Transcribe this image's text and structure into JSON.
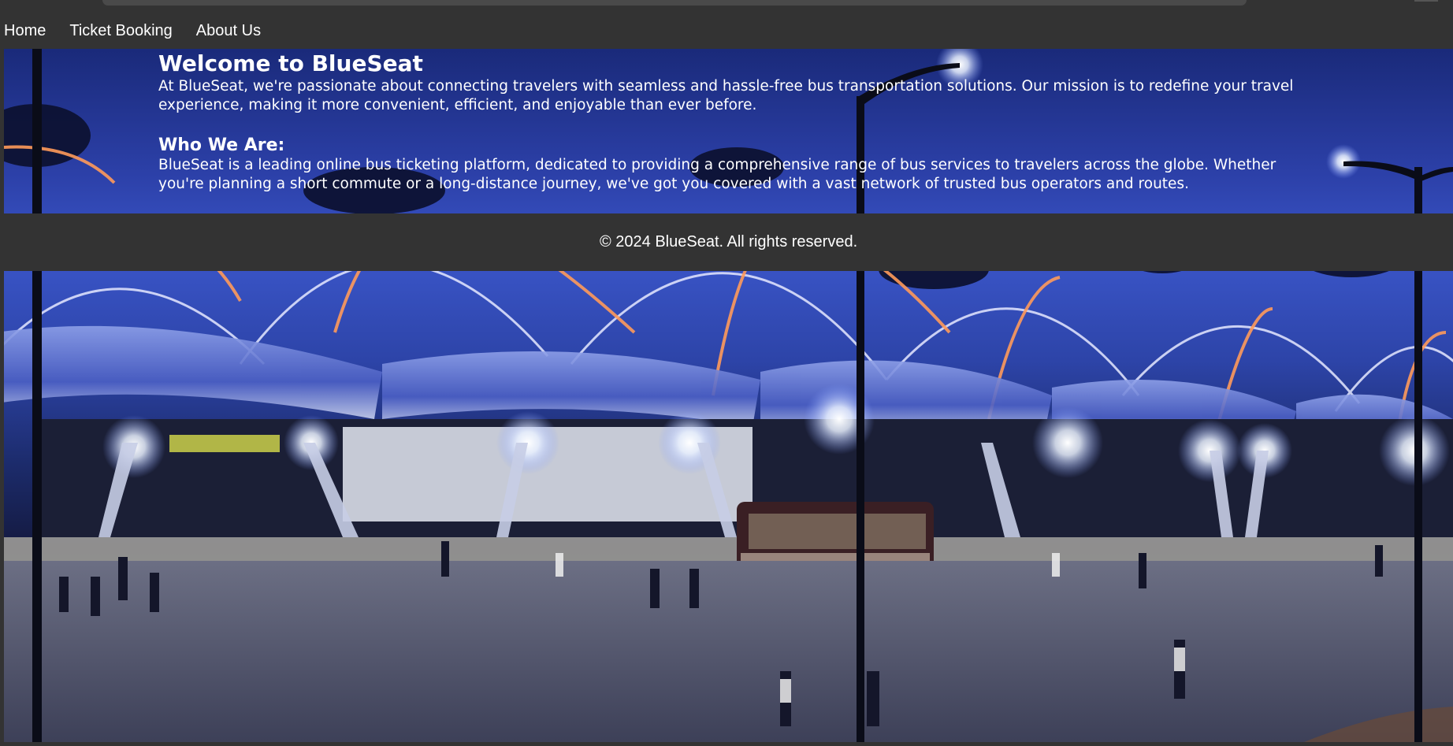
{
  "nav": {
    "items": [
      {
        "label": "Home"
      },
      {
        "label": "Ticket Booking"
      },
      {
        "label": "About Us"
      }
    ]
  },
  "hero": {
    "title": "Welcome to BlueSeat",
    "intro": "At BlueSeat, we're passionate about connecting travelers with seamless and hassle-free bus transportation solutions. Our mission is to redefine your travel experience, making it more convenient, efficient, and enjoyable than ever before.",
    "section_heading": "Who We Are:",
    "section_text": "BlueSeat is a leading online bus ticketing platform, dedicated to providing a comprehensive range of bus services to travelers across the globe. Whether you're planning a short commute or a long-distance journey, we've got you covered with a vast network of trusted bus operators and routes."
  },
  "footer": {
    "copyright": "© 2024 BlueSeat. All rights reserved."
  },
  "colors": {
    "page_background": "#333333",
    "text": "#ffffff",
    "night_sky": "#3a55c8"
  }
}
